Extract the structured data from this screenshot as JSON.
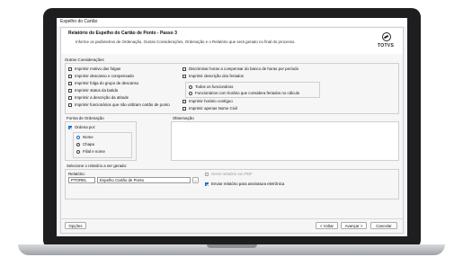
{
  "window": {
    "title": "Espelho do Cartão"
  },
  "header": {
    "title": "Relatório do Espelho do Cartão de Ponto - Passo 3",
    "description": "Informe os parâmetros de Ordenação, Outras Considerações, Ordenação e o Relatório que será gerado no final do processo.",
    "logo_text": "TOTVS"
  },
  "outras": {
    "legend": "Outras Considerações",
    "left": [
      {
        "label": "Imprimir motivo das folgas",
        "checked": false
      },
      {
        "label": "Imprimir descanso e compensado",
        "checked": false
      },
      {
        "label": "Imprimir folga do grupo de descanso",
        "checked": false
      },
      {
        "label": "Imprimir status da batida",
        "checked": false
      },
      {
        "label": "Imprimir a descrição da atitude",
        "checked": false
      },
      {
        "label": "Imprimir funcionários que não utilizam cartão de ponto",
        "checked": false
      }
    ],
    "right_top": [
      {
        "label": "Discriminar horas a compensar do banco de horas por período",
        "checked": false
      },
      {
        "label": "Imprimir descrição dos feriados",
        "checked": false
      }
    ],
    "radios": [
      {
        "label": "Todos os funcionários",
        "selected": false
      },
      {
        "label": "Funcionários com horário que considera feriados no cálculo",
        "selected": false
      }
    ],
    "right_bottom": [
      {
        "label": "Imprimir horário contíguo",
        "checked": false
      },
      {
        "label": "Imprimir apenas Nome Civil",
        "checked": false
      }
    ]
  },
  "ordenacao": {
    "legend": "Forma de Ordenação",
    "ordena_label": "Ordena por:",
    "ordena_checked": true,
    "options": [
      {
        "label": "Nome",
        "selected": true
      },
      {
        "label": "Chapa",
        "selected": false
      },
      {
        "label": "Filial e nome",
        "selected": false
      }
    ]
  },
  "observacao": {
    "legend": "Observação",
    "value": ""
  },
  "relatorio": {
    "section_label": "Selecione o relatório a ser gerado:",
    "field_label": "Relatório:",
    "code": "PTOREL 01.0",
    "name": "Espelho Cartão de Ponto",
    "lookup_label": "...",
    "pdf_label": "Gerar relatório em PDF",
    "pdf_checked": false,
    "assinatura_label": "Enviar relatório para assinatura eletrônica",
    "assinatura_checked": true
  },
  "footer": {
    "options_label": "Opções",
    "back_label": "< Voltar",
    "next_label": "Avançar >",
    "cancel_label": "Cancelar"
  }
}
